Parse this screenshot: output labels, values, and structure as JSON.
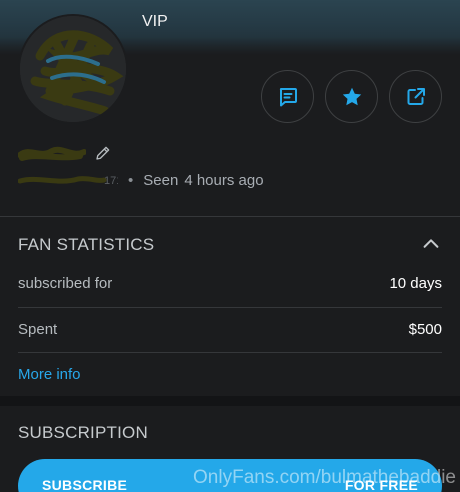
{
  "header": {
    "badge": "VIP"
  },
  "profile": {
    "handle_suffix": "171",
    "separator": "•",
    "seen_label": "Seen",
    "seen_time": "4 hours ago"
  },
  "actions": [
    {
      "name": "message",
      "icon": "chat-icon"
    },
    {
      "name": "favorite",
      "icon": "star-icon"
    },
    {
      "name": "share",
      "icon": "share-icon"
    }
  ],
  "fan_statistics": {
    "title": "FAN STATISTICS",
    "rows": [
      {
        "label": "subscribed for",
        "value": "10 days"
      },
      {
        "label": "Spent",
        "value": "$500"
      }
    ],
    "more_info": "More info"
  },
  "subscription": {
    "title": "SUBSCRIPTION",
    "button_left": "SUBSCRIBE",
    "button_right": "FOR FREE"
  },
  "watermark": "OnlyFans.com/bulmathebaddie",
  "colors": {
    "accent": "#24a8e9",
    "background": "#1b1c1e",
    "divider": "#35373a"
  }
}
